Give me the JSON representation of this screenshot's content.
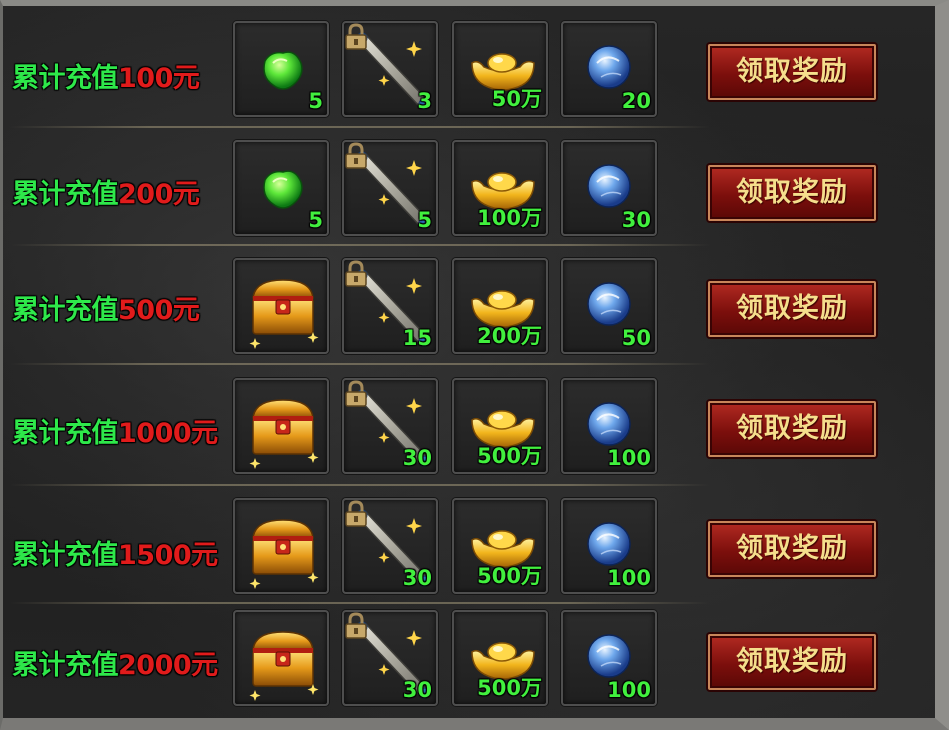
{
  "reward_button_label": "领取奖励",
  "label_prefix": "累计充值",
  "colors": {
    "label_green": "#2ee84a",
    "label_red": "#e11b1b",
    "count_green": "#41f03e",
    "button_text": "#f5de8c"
  },
  "rows": [
    {
      "amount": "100元",
      "items": [
        {
          "icon": "green-gem-icon",
          "count": "5"
        },
        {
          "icon": "scroll-icon",
          "count": "3",
          "locked": true
        },
        {
          "icon": "gold-ingot-icon",
          "count": "50万"
        },
        {
          "icon": "blue-orb-icon",
          "count": "20"
        }
      ]
    },
    {
      "amount": "200元",
      "items": [
        {
          "icon": "green-gem-icon",
          "count": "5"
        },
        {
          "icon": "scroll-icon",
          "count": "5",
          "locked": true
        },
        {
          "icon": "gold-ingot-icon",
          "count": "100万"
        },
        {
          "icon": "blue-orb-icon",
          "count": "30"
        }
      ]
    },
    {
      "amount": "500元",
      "items": [
        {
          "icon": "treasure-chest-icon",
          "count": ""
        },
        {
          "icon": "scroll-icon",
          "count": "15",
          "locked": true
        },
        {
          "icon": "gold-ingot-icon",
          "count": "200万"
        },
        {
          "icon": "blue-orb-icon",
          "count": "50"
        }
      ]
    },
    {
      "amount": "1000元",
      "items": [
        {
          "icon": "treasure-chest-icon",
          "count": ""
        },
        {
          "icon": "scroll-icon",
          "count": "30",
          "locked": true
        },
        {
          "icon": "gold-ingot-icon",
          "count": "500万"
        },
        {
          "icon": "blue-orb-icon",
          "count": "100"
        }
      ]
    },
    {
      "amount": "1500元",
      "items": [
        {
          "icon": "treasure-chest-icon",
          "count": ""
        },
        {
          "icon": "scroll-icon",
          "count": "30",
          "locked": true
        },
        {
          "icon": "gold-ingot-icon",
          "count": "500万"
        },
        {
          "icon": "blue-orb-icon",
          "count": "100"
        }
      ]
    },
    {
      "amount": "2000元",
      "items": [
        {
          "icon": "treasure-chest-icon",
          "count": ""
        },
        {
          "icon": "scroll-icon",
          "count": "30",
          "locked": true
        },
        {
          "icon": "gold-ingot-icon",
          "count": "500万"
        },
        {
          "icon": "blue-orb-icon",
          "count": "100"
        }
      ]
    }
  ]
}
